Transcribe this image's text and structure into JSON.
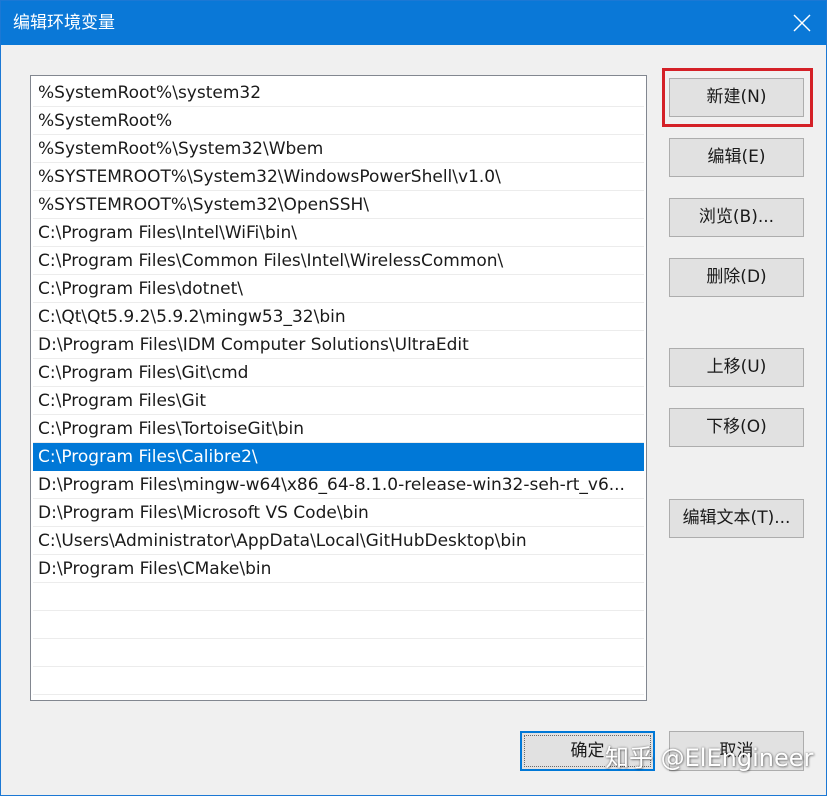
{
  "window": {
    "title": "编辑环境变量",
    "close_icon": "close-icon"
  },
  "path_list": {
    "selected_index": 13,
    "items": [
      "%SystemRoot%\\system32",
      "%SystemRoot%",
      "%SystemRoot%\\System32\\Wbem",
      "%SYSTEMROOT%\\System32\\WindowsPowerShell\\v1.0\\",
      "%SYSTEMROOT%\\System32\\OpenSSH\\",
      "C:\\Program Files\\Intel\\WiFi\\bin\\",
      "C:\\Program Files\\Common Files\\Intel\\WirelessCommon\\",
      "C:\\Program Files\\dotnet\\",
      "C:\\Qt\\Qt5.9.2\\5.9.2\\mingw53_32\\bin",
      "D:\\Program Files\\IDM Computer Solutions\\UltraEdit",
      "C:\\Program Files\\Git\\cmd",
      "C:\\Program Files\\Git",
      "C:\\Program Files\\TortoiseGit\\bin",
      "C:\\Program Files\\Calibre2\\",
      "D:\\Program Files\\mingw-w64\\x86_64-8.1.0-release-win32-seh-rt_v6...",
      "D:\\Program Files\\Microsoft VS Code\\bin",
      "C:\\Users\\Administrator\\AppData\\Local\\GitHubDesktop\\bin",
      "D:\\Program Files\\CMake\\bin",
      "",
      "",
      "",
      ""
    ]
  },
  "buttons": {
    "new": "新建(N)",
    "edit": "编辑(E)",
    "browse": "浏览(B)...",
    "delete": "删除(D)",
    "move_up": "上移(U)",
    "move_down": "下移(O)",
    "edit_text": "编辑文本(T)...",
    "ok": "确定",
    "cancel": "取消"
  },
  "colors": {
    "titlebar": "#0a78d7",
    "selection": "#0078d7",
    "highlight_box": "#d42027"
  },
  "watermark": "知乎 @ElEngineer"
}
